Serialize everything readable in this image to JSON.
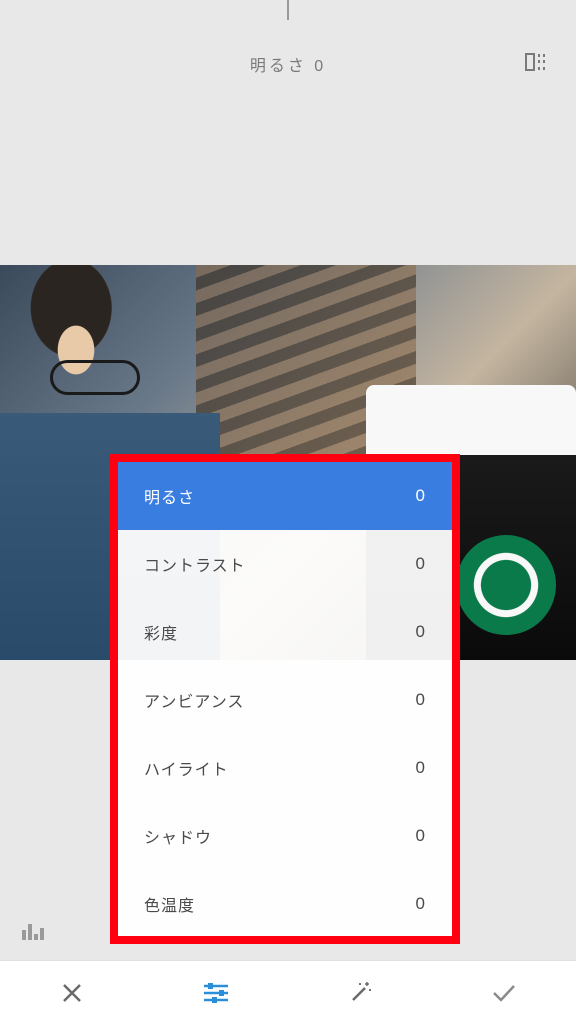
{
  "header": {
    "current_adjustment": "明るさ",
    "current_value": "0"
  },
  "adjustments": [
    {
      "label": "明るさ",
      "value": "0",
      "selected": true
    },
    {
      "label": "コントラスト",
      "value": "0",
      "selected": false
    },
    {
      "label": "彩度",
      "value": "0",
      "selected": false
    },
    {
      "label": "アンビアンス",
      "value": "0",
      "selected": false
    },
    {
      "label": "ハイライト",
      "value": "0",
      "selected": false
    },
    {
      "label": "シャドウ",
      "value": "0",
      "selected": false
    },
    {
      "label": "色温度",
      "value": "0",
      "selected": false
    }
  ],
  "colors": {
    "accent": "#3a7de0",
    "highlight_border": "#ff0010",
    "toolbar_active": "#2a8fd8",
    "icon_gray": "#7a7a7a"
  }
}
